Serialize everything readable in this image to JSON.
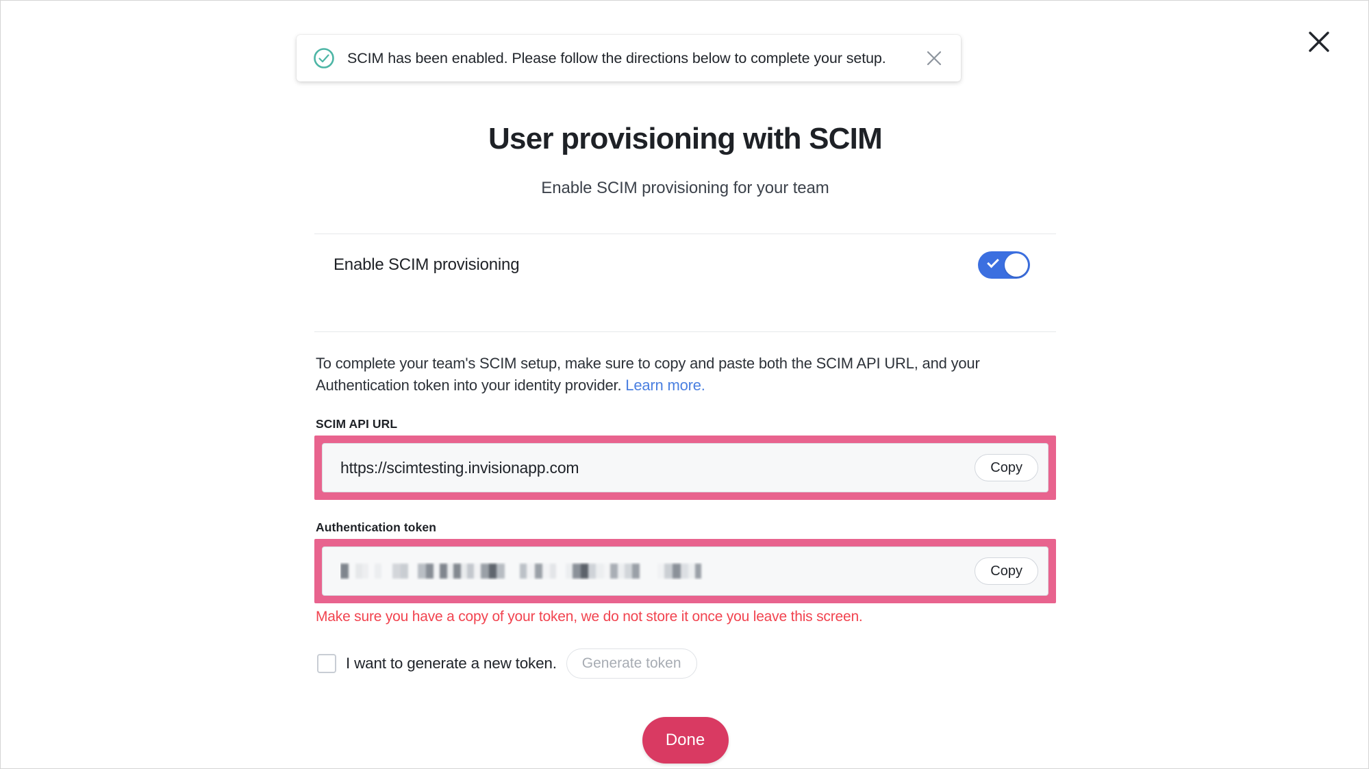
{
  "window": {
    "close_icon": "close-icon"
  },
  "toast": {
    "icon": "circle-check-icon",
    "message": "SCIM has been enabled. Please follow the directions below to complete your setup.",
    "close_icon": "close-icon",
    "icon_color": "#4cb5a5"
  },
  "header": {
    "title": "User provisioning with SCIM",
    "subtitle": "Enable SCIM provisioning for your team"
  },
  "toggle_section": {
    "label": "Enable SCIM provisioning",
    "enabled": true,
    "on_color": "#3b6fe0"
  },
  "description": {
    "text_before_link": "To complete your team's SCIM setup, make sure to copy and paste both the SCIM API URL, and your Authentication token into your identity provider. ",
    "link_label": "Learn more.",
    "link_color": "#4a7fe0"
  },
  "scim_url_field": {
    "label": "SCIM API URL",
    "value": "https://scimtesting.invisionapp.com",
    "copy_label": "Copy",
    "highlight_color": "#e8638e",
    "highlighted": true
  },
  "token_field": {
    "label": "Authentication token",
    "value": "",
    "redacted": true,
    "copy_label": "Copy",
    "highlight_color": "#e8638e",
    "highlighted": true,
    "warning": "Make sure you have a copy of your token, we do not store it once you leave this screen.",
    "warning_color": "#f1434f"
  },
  "generate_section": {
    "checkbox_checked": false,
    "checkbox_label": "I want to generate a new token.",
    "button_label": "Generate token",
    "button_disabled": true
  },
  "footer": {
    "done_label": "Done",
    "done_color": "#d93a62"
  }
}
